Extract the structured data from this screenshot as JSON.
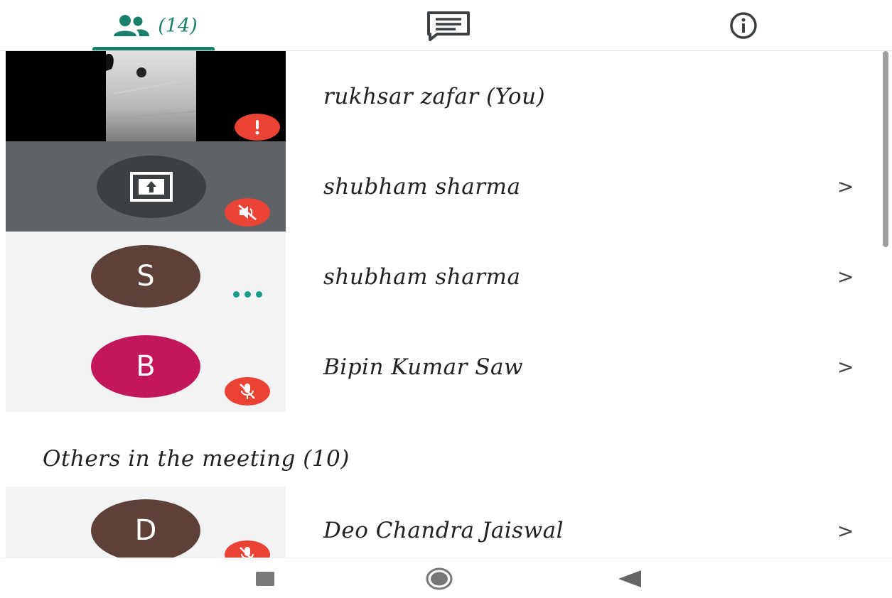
{
  "tabs": {
    "people_count": "(14)",
    "active": "people"
  },
  "participants": [
    {
      "name": "rukhsar zafar (You)",
      "tile": "video",
      "status": "alert"
    },
    {
      "name": "shubham sharma",
      "tile": "presenting",
      "status": "muted"
    },
    {
      "name": "shubham sharma",
      "initial": "S",
      "avatar_color": "#5d4037",
      "status": "speaking"
    },
    {
      "name": "Bipin Kumar Saw",
      "initial": "B",
      "avatar_color": "#c2185b",
      "status": "muted"
    }
  ],
  "others_heading": "Others in the meeting (10)",
  "others": [
    {
      "name": "Deo Chandra Jaiswal",
      "initial": "D",
      "avatar_color": "#5d4037",
      "status": "muted"
    }
  ],
  "chevron": ">",
  "colors": {
    "accent": "#1a7f6b",
    "muted_badge": "#ea4335"
  }
}
